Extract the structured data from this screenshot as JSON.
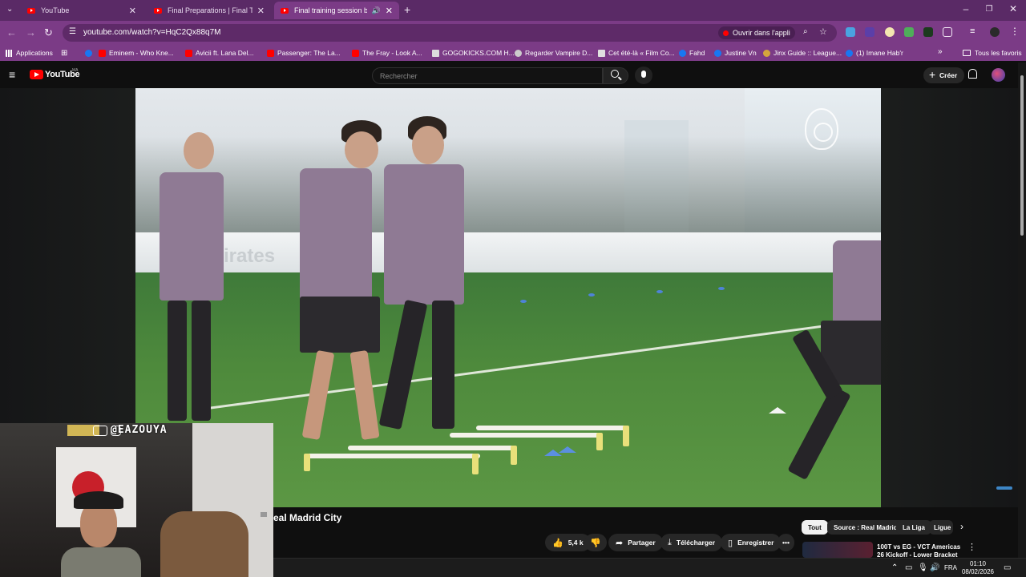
{
  "browser": {
    "tabs": [
      {
        "title": "YouTube",
        "active": false
      },
      {
        "title": "Final Preparations | Final Touch",
        "active": false
      },
      {
        "title": "Final training session before",
        "active": true
      }
    ],
    "new_tab_icon": "plus-icon",
    "url": "youtube.com/watch?v=HqC2Qx88q7M",
    "open_app_label": "Ouvrir dans l'appli",
    "bookmarks": [
      {
        "label": "Applications",
        "icon": "apps-grid-icon",
        "color": "#4f7cf0"
      },
      {
        "label": "Eminem - Who Kne...",
        "icon": "youtube-icon",
        "color": "#ff0000"
      },
      {
        "label": "Avicii ft. Lana Del...",
        "icon": "youtube-icon",
        "color": "#ff0000"
      },
      {
        "label": "Passenger: The La...",
        "icon": "youtube-icon",
        "color": "#ff0000"
      },
      {
        "label": "The Fray - Look A...",
        "icon": "youtube-icon",
        "color": "#ff0000"
      },
      {
        "label": "GOGOKICKS.COM H...",
        "icon": "site-icon",
        "color": "#dddddd"
      },
      {
        "label": "Regarder Vampire D...",
        "icon": "site-icon",
        "color": "#cccccc"
      },
      {
        "label": "Cet été-là « Film Co...",
        "icon": "site-icon",
        "color": "#e0e0e0"
      },
      {
        "label": "Fahd",
        "icon": "facebook-icon",
        "color": "#1877f2"
      },
      {
        "label": "Justine Vn",
        "icon": "facebook-icon",
        "color": "#1877f2"
      },
      {
        "label": "Jinx Guide :: League...",
        "icon": "site-icon",
        "color": "#d4a63c"
      },
      {
        "label": "(1) Imane Hab'r",
        "icon": "facebook-icon",
        "color": "#1877f2"
      }
    ],
    "all_bookmarks_label": "Tous les favoris"
  },
  "youtube": {
    "logo_text": "YouTube",
    "country_code": "MA",
    "search_placeholder": "Rechercher",
    "create_label": "Créer",
    "video_title": "eal Madrid City",
    "video_board_text": "irates",
    "actions": {
      "likes": "5,4 k",
      "share": "Partager",
      "download": "Télécharger",
      "save": "Enregistrer"
    },
    "chips": [
      {
        "label": "Tout",
        "active": true
      },
      {
        "label": "Source : Real Madrid",
        "active": false
      },
      {
        "label": "La Liga",
        "active": false
      },
      {
        "label": "Ligue",
        "active": false
      }
    ],
    "recommended_title": "100T vs EG - VCT Americas 26 Kickoff - Lower Bracket"
  },
  "webcam": {
    "handle": "@EAZOUYA"
  },
  "taskbar": {
    "language": "FRA",
    "time": "01:10",
    "date": "08/02/2026"
  }
}
